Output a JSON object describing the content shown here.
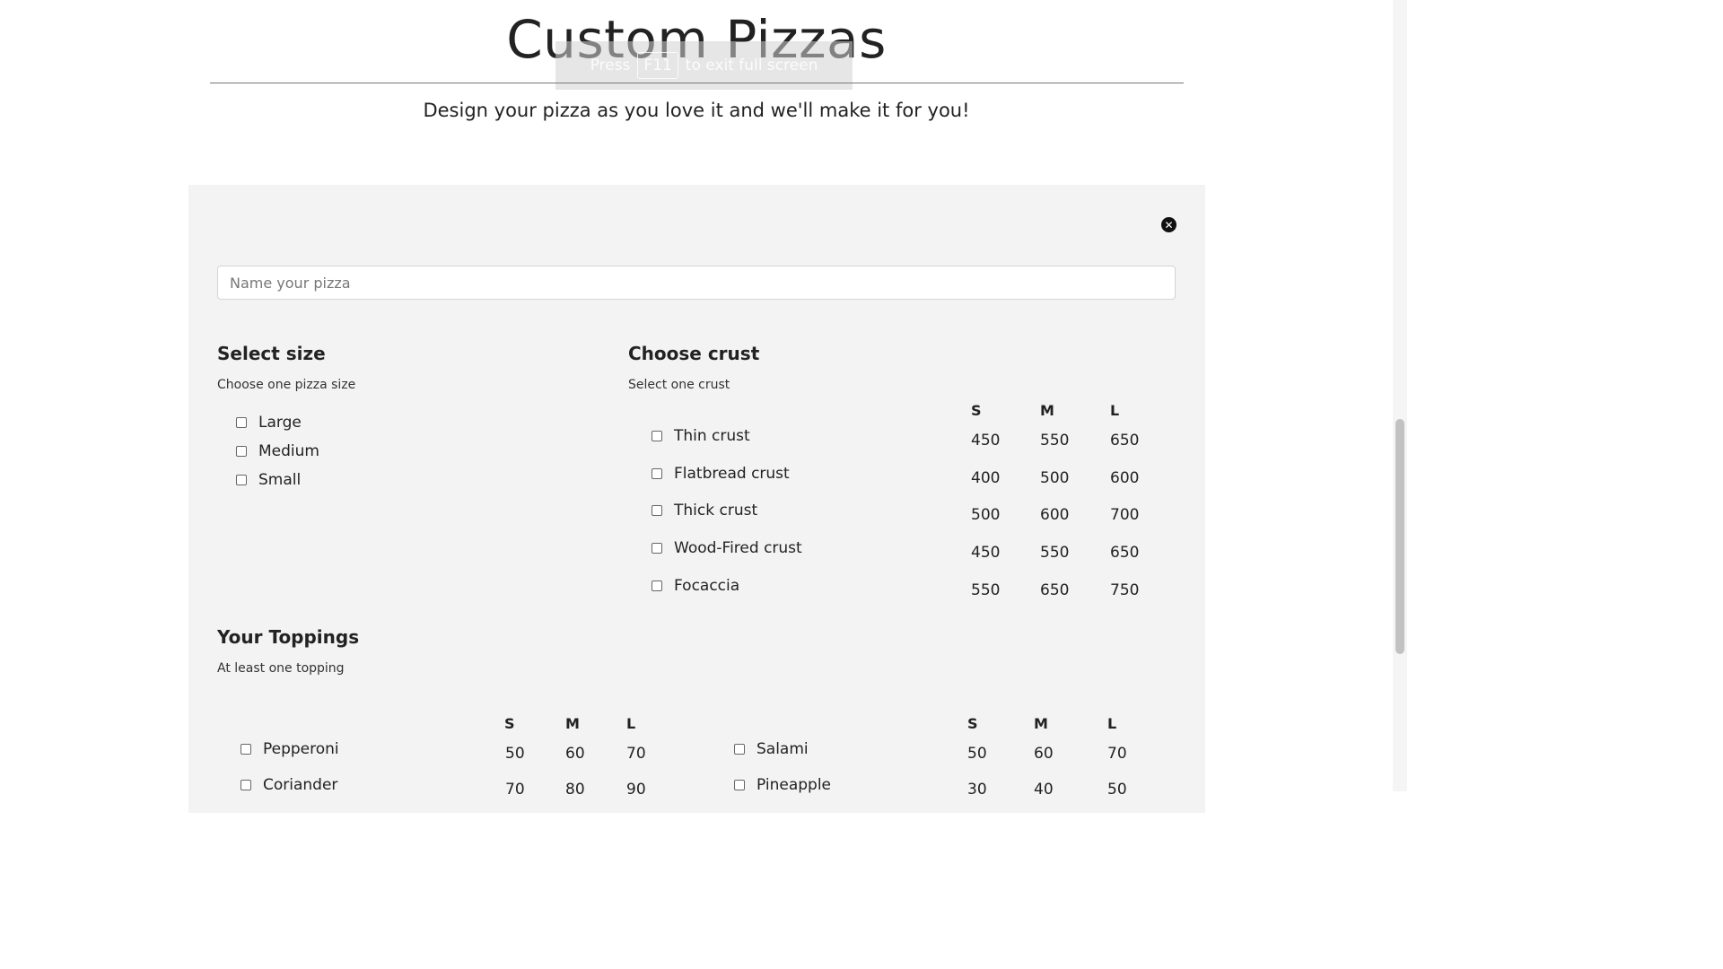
{
  "header": {
    "title": "Custom Pizzas",
    "subtitle": "Design your pizza as you love it and we'll make it for you!"
  },
  "fullscreen_hint": {
    "before": "Press",
    "key": "F11",
    "after": "to exit full screen"
  },
  "form": {
    "close_icon": "close-circle-icon",
    "name_placeholder": "Name your pizza"
  },
  "size_section": {
    "title": "Select size",
    "hint": "Choose one pizza size",
    "options": [
      "Large",
      "Medium",
      "Small"
    ]
  },
  "crust_section": {
    "title": "Choose crust",
    "hint": "Select one crust",
    "columns": [
      "S",
      "M",
      "L"
    ],
    "rows": [
      {
        "label": "Thin crust",
        "prices": [
          "450",
          "550",
          "650"
        ]
      },
      {
        "label": "Flatbread crust",
        "prices": [
          "400",
          "500",
          "600"
        ]
      },
      {
        "label": "Thick crust",
        "prices": [
          "500",
          "600",
          "700"
        ]
      },
      {
        "label": "Wood-Fired crust",
        "prices": [
          "450",
          "550",
          "650"
        ]
      },
      {
        "label": "Focaccia",
        "prices": [
          "550",
          "650",
          "750"
        ]
      }
    ]
  },
  "toppings_section": {
    "title": "Your Toppings",
    "hint": "At least one topping",
    "columns": [
      "S",
      "M",
      "L"
    ],
    "left": [
      {
        "label": "Pepperoni",
        "prices": [
          "50",
          "60",
          "70"
        ]
      },
      {
        "label": "Coriander",
        "prices": [
          "70",
          "80",
          "90"
        ]
      }
    ],
    "right": [
      {
        "label": "Salami",
        "prices": [
          "50",
          "60",
          "70"
        ]
      },
      {
        "label": "Pineapple",
        "prices": [
          "30",
          "40",
          "50"
        ]
      }
    ]
  },
  "colors": {
    "panel_bg": "#f3f3f3",
    "text": "#222222",
    "close_icon_bg": "#111111"
  }
}
